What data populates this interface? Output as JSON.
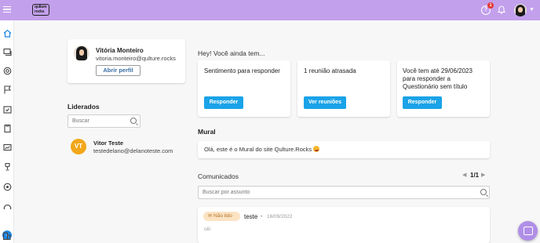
{
  "app": {
    "logo_text": "qulture rocks"
  },
  "topbar": {
    "help_badge_count": "1",
    "icons": [
      "menu-icon",
      "help-icon",
      "bell-icon",
      "user-avatar",
      "chevron-down-icon"
    ]
  },
  "sidebar": {
    "icons": [
      "home-icon",
      "chat-icon",
      "target-icon",
      "flag-icon",
      "calendar-check-icon",
      "clipboard-icon",
      "chart-icon",
      "trophy-icon",
      "radar-icon",
      "chevron-down-icon",
      "building-icon"
    ]
  },
  "profile": {
    "name": "Vitória Monteiro",
    "email": "vitoria.monteiro@qulture.rocks",
    "open_profile_label": "Abrir perfil"
  },
  "liderados": {
    "title": "Liderados",
    "search_placeholder": "Buscar",
    "items": [
      {
        "initials": "VT",
        "name": "Vitor Teste",
        "email": "testedelano@delanoteste.com"
      }
    ]
  },
  "pending": {
    "title": "Hey! Você ainda tem...",
    "cards": [
      {
        "lines": [
          "Sentimento para responder"
        ],
        "button": "Responder"
      },
      {
        "lines": [
          "1 reunião atrasada"
        ],
        "button": "Ver reuniões"
      },
      {
        "lines": [
          "Você tem até 29/06/2023",
          "para responder a",
          "Questionário sem título"
        ],
        "button": "Responder"
      }
    ]
  },
  "mural": {
    "title": "Mural",
    "text": "Olá, este é o Mural do site Qulture.Rocks"
  },
  "comunicados": {
    "title": "Comunicados",
    "pagination": "1/1",
    "search_placeholder": "Buscar por assunto",
    "items": [
      {
        "status": "Não lido",
        "title": "teste",
        "date": "16/09/2022",
        "body": "oiii"
      }
    ]
  },
  "colors": {
    "topbar": "#c3a0ec",
    "accent_blue": "#1aa3e8",
    "avatar_orange": "#f2a71a",
    "badge_red": "#e53935"
  }
}
